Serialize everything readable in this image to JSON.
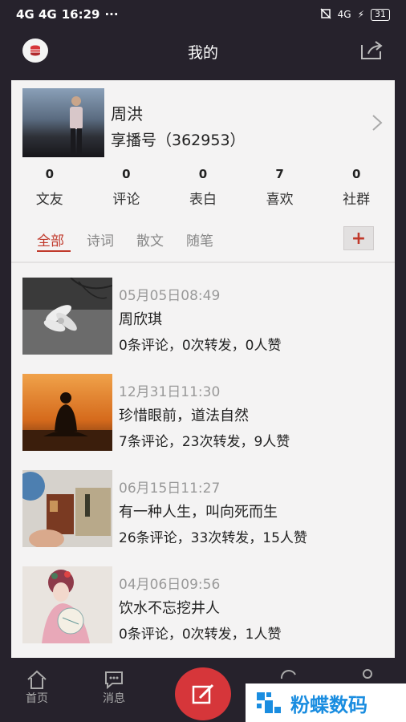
{
  "status_bar": {
    "signal": "4G 4G",
    "time": "16:29",
    "dots": "···",
    "network": "4G",
    "battery": "31"
  },
  "header": {
    "title": "我的"
  },
  "profile": {
    "name": "周洪",
    "id_text": "享播号（362953）"
  },
  "stats": [
    {
      "count": "0",
      "label": "文友"
    },
    {
      "count": "0",
      "label": "评论"
    },
    {
      "count": "0",
      "label": "表白"
    },
    {
      "count": "7",
      "label": "喜欢"
    },
    {
      "count": "0",
      "label": "社群"
    }
  ],
  "tabs": [
    "全部",
    "诗词",
    "散文",
    "随笔"
  ],
  "add_label": "+",
  "posts": [
    {
      "date": "05月05日08:49",
      "title": "周欣琪",
      "meta": "0条评论，0次转发，0人赞"
    },
    {
      "date": "12月31日11:30",
      "title": "珍惜眼前，道法自然",
      "meta": "7条评论，23次转发，9人赞"
    },
    {
      "date": "06月15日11:27",
      "title": "有一种人生，叫向死而生",
      "meta": "26条评论，33次转发，15人赞"
    },
    {
      "date": "04月06日09:56",
      "title": "饮水不忘挖井人",
      "meta": "0条评论，0次转发，1人赞"
    }
  ],
  "nav": {
    "home": "首页",
    "messages": "消息"
  },
  "watermark": "粉蝶数码",
  "colors": {
    "accent": "#c0392b",
    "fab": "#d6363a",
    "background": "#26222c"
  }
}
